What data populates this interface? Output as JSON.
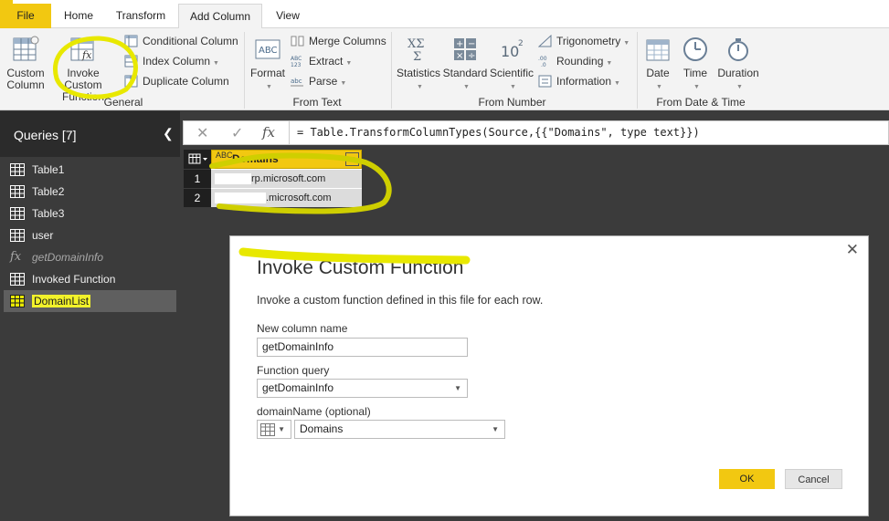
{
  "tabs": [
    {
      "label": "File"
    },
    {
      "label": "Home"
    },
    {
      "label": "Transform"
    },
    {
      "label": "Add Column"
    },
    {
      "label": "View"
    }
  ],
  "ribbon": {
    "general": {
      "custom_column": "Custom Column",
      "custom_column_l1": "Custom",
      "custom_column_l2": "Column",
      "invoke_l1": "Invoke Custom",
      "invoke_l2": "Function",
      "conditional_column": "Conditional Column",
      "index_column": "Index Column",
      "duplicate_column": "Duplicate Column",
      "label": "General"
    },
    "from_text": {
      "format": "Format",
      "merge_columns": "Merge Columns",
      "extract": "Extract",
      "parse": "Parse",
      "label": "From Text"
    },
    "from_number": {
      "statistics": "Statistics",
      "standard": "Standard",
      "scientific": "Scientific",
      "trigonometry": "Trigonometry",
      "rounding": "Rounding",
      "information": "Information",
      "label": "From Number"
    },
    "from_date_time": {
      "date": "Date",
      "time": "Time",
      "duration": "Duration",
      "label": "From Date & Time"
    }
  },
  "queries": {
    "title": "Queries [7]",
    "items": [
      {
        "label": "Table1",
        "type": "table"
      },
      {
        "label": "Table2",
        "type": "table"
      },
      {
        "label": "Table3",
        "type": "table"
      },
      {
        "label": "user",
        "type": "table"
      },
      {
        "label": "getDomainInfo",
        "type": "function"
      },
      {
        "label": "Invoked Function",
        "type": "table"
      },
      {
        "label": "DomainList",
        "type": "table",
        "selected": true
      }
    ]
  },
  "formula_bar": {
    "cancel": "✕",
    "confirm": "✓",
    "fx": "fx",
    "formula": "= Table.TransformColumnTypes(Source,{{\"Domains\", type text}})"
  },
  "grid": {
    "column_header": "Domains",
    "type_icon": "ABC",
    "rows": [
      {
        "num": "1",
        "suffix": "rp.microsoft.com"
      },
      {
        "num": "2",
        "suffix": ".microsoft.com"
      }
    ]
  },
  "dialog": {
    "title": "Invoke Custom Function",
    "close": "✕",
    "description": "Invoke a custom function defined in this file for each row.",
    "new_column_label": "New column name",
    "new_column_value": "getDomainInfo",
    "function_query_label": "Function query",
    "function_query_value": "getDomainInfo",
    "param_label": "domainName (optional)",
    "param_value": "Domains",
    "ok": "OK",
    "cancel": "Cancel"
  },
  "colors": {
    "accent": "#f2c811",
    "highlighter": "#e8e800",
    "pane_bg": "#3b3b3b"
  }
}
